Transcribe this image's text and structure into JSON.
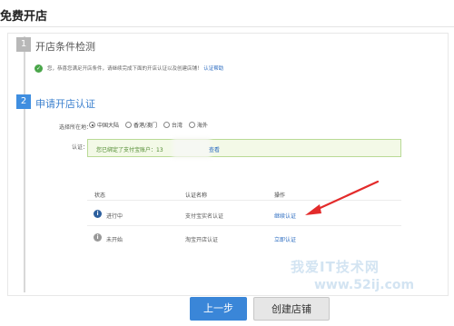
{
  "page": {
    "title": "免费开店"
  },
  "steps": [
    {
      "number": "1",
      "title": "开店条件检测"
    },
    {
      "number": "2",
      "title": "申请开店认证"
    }
  ],
  "notice": {
    "text": "您，恭喜您满足开店条件，请继续完成下面的开店认证以及创建店铺！",
    "link": "认证帮助"
  },
  "location": {
    "label": "选择所在地：",
    "options": [
      {
        "label": "中国大陆",
        "selected": true
      },
      {
        "label": "香港/澳门",
        "selected": false
      },
      {
        "label": "台湾",
        "selected": false
      },
      {
        "label": "海外",
        "selected": false
      }
    ]
  },
  "auth": {
    "label": "认证：",
    "message": "您已绑定了支付宝账户：13",
    "link": "查看"
  },
  "table": {
    "headers": [
      "状态",
      "认证名称",
      "操作"
    ],
    "rows": [
      {
        "status": "进行中",
        "name": "支付宝实名认证",
        "action": "继续认证",
        "icon": "info-active-icon"
      },
      {
        "status": "未开始",
        "name": "淘宝开店认证",
        "action": "立即认证",
        "icon": "info-pending-icon"
      }
    ]
  },
  "buttons": {
    "prev": "上一步",
    "create": "创建店铺"
  },
  "watermark": {
    "main": "我爱IT技术网",
    "sub": "www.52ij.com"
  },
  "colors": {
    "accent": "#3a86d8",
    "link": "#2a6bc0",
    "arrow": "#e32b2b"
  }
}
